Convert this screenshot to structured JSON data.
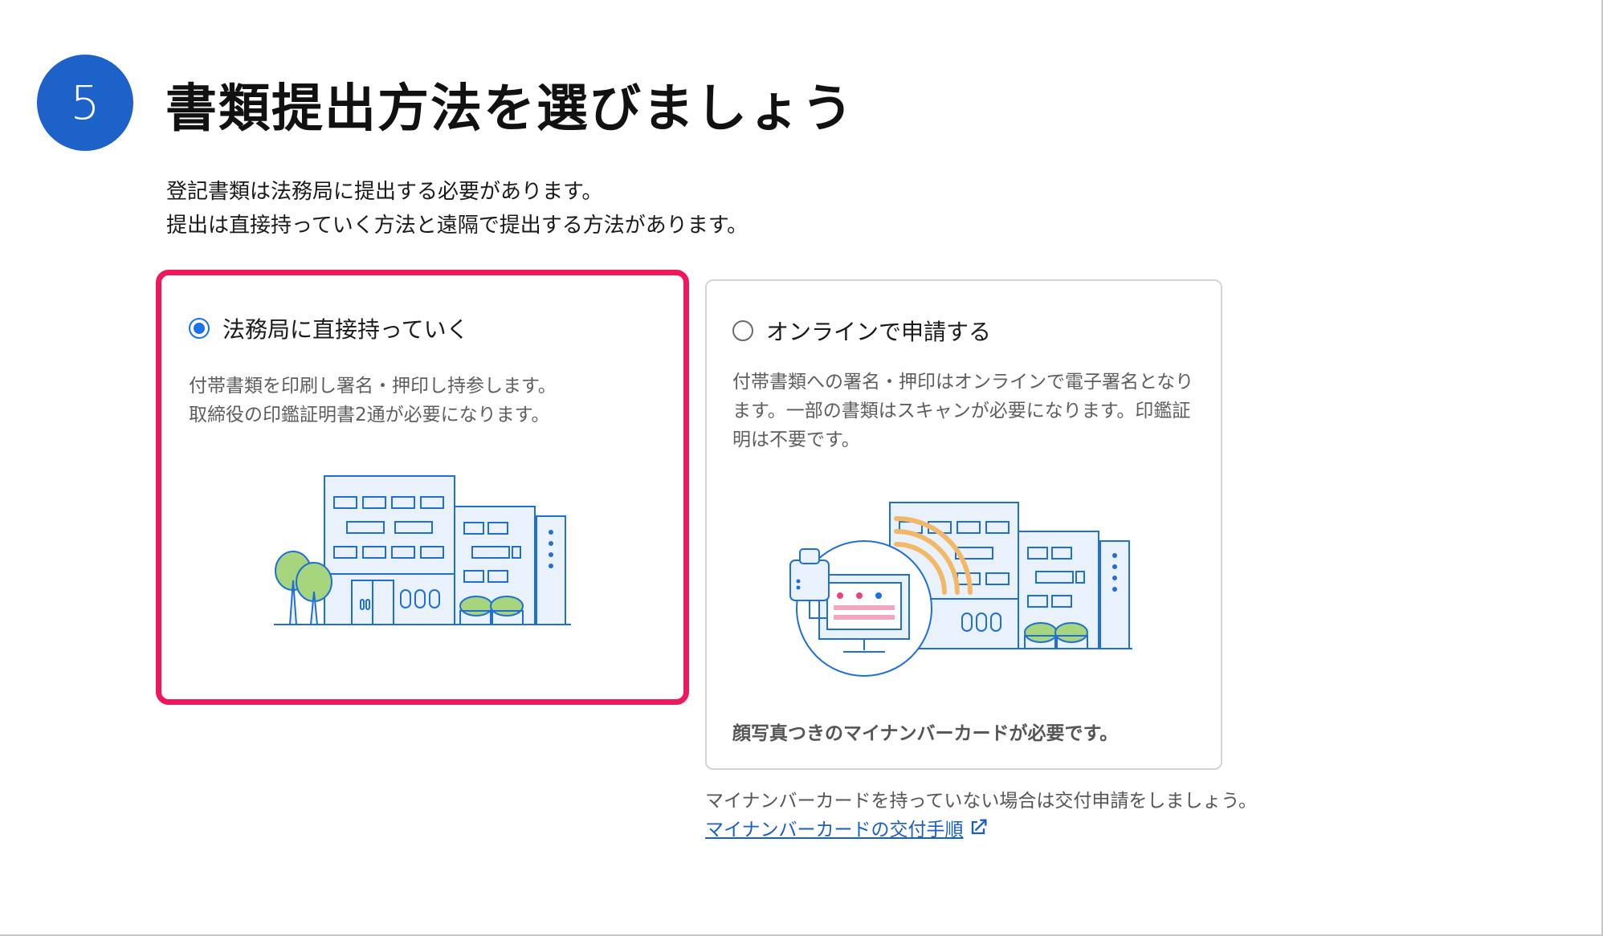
{
  "step": {
    "number": "5",
    "title": "書類提出方法を選びましょう"
  },
  "intro": {
    "line1": "登記書類は法務局に提出する必要があります。",
    "line2": "提出は直接持っていく方法と遠隔で提出する方法があります。"
  },
  "options": [
    {
      "label": "法務局に直接持っていく",
      "selected": true,
      "desc_line1": "付帯書類を印刷し署名・押印し持参します。",
      "desc_line2": "取締役の印鑑証明書2通が必要になります。"
    },
    {
      "label": "オンラインで申請する",
      "selected": false,
      "desc": "付帯書類への署名・押印はオンラインで電子署名となります。一部の書類はスキャンが必要になります。印鑑証明は不要です。",
      "note": "顔写真つきのマイナンバーカードが必要です。"
    }
  ],
  "below_note": "マイナンバーカードを持っていない場合は交付申請をしましょう。",
  "link": {
    "label": "マイナンバーカードの交付手順",
    "icon": "external-link-icon"
  },
  "colors": {
    "step_circle": "#1c62c9",
    "selected_border": "#f0185c",
    "card_border": "#d4d4d4",
    "radio_selected": "#1a73e8",
    "link": "#1a5fc2",
    "illus_stroke": "#1f6fd6",
    "illus_fill": "#e8f1fc",
    "tree_green": "#a6d57e",
    "wifi_orange": "#f2b866"
  }
}
